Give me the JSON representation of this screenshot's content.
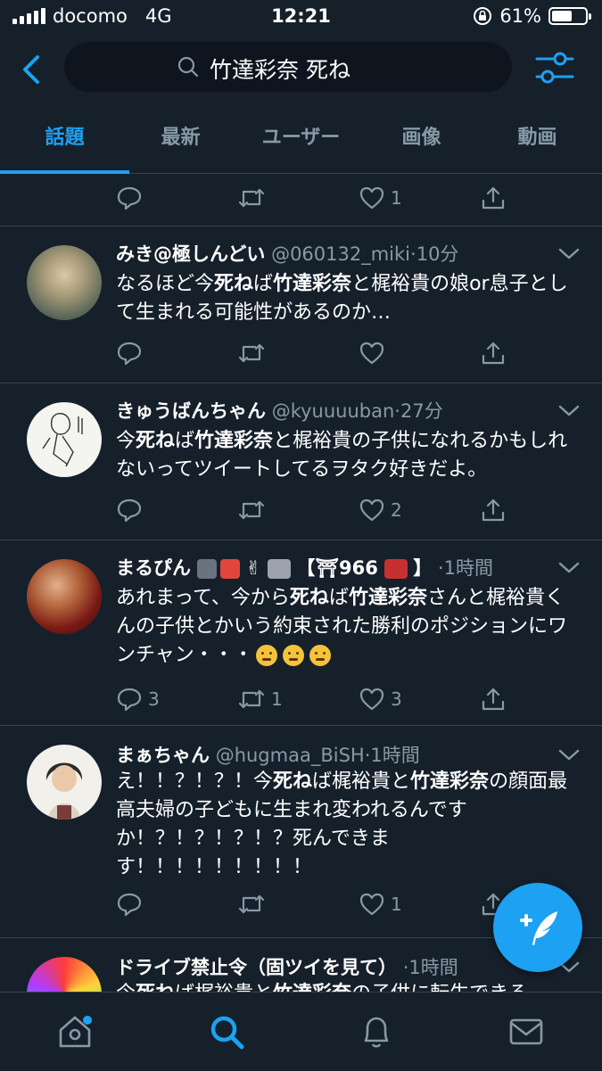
{
  "status_bar": {
    "carrier": "docomo",
    "network": "4G",
    "time": "12:21",
    "battery": "61%",
    "battery_level": 0.61
  },
  "search": {
    "query": "竹達彩奈 死ね"
  },
  "tabs": [
    {
      "label": "話題",
      "active": true
    },
    {
      "label": "最新",
      "active": false
    },
    {
      "label": "ユーザー",
      "active": false
    },
    {
      "label": "画像",
      "active": false
    },
    {
      "label": "動画",
      "active": false
    }
  ],
  "prev_tweet_actions": {
    "reply": "",
    "retweet": "",
    "like": "1"
  },
  "tweets": [
    {
      "name": "みき@極しんどい",
      "handle": "@060132_miki",
      "time": "10分",
      "body_parts": [
        "なるほど今",
        "死ね",
        "ば",
        "竹達彩奈",
        "と梶裕貴の娘or息子として生まれる可能性があるのか…"
      ],
      "reply": "",
      "retweet": "",
      "like": ""
    },
    {
      "name": "きゅうばんちゃん",
      "handle": "@kyuuuuban",
      "time": "27分",
      "body_parts": [
        "今",
        "死ね",
        "ば",
        "竹達彩奈",
        "と梶裕貴の子供になれるかもしれないってツイートしてるヲタク好きだよ。"
      ],
      "reply": "",
      "retweet": "",
      "like": "2"
    },
    {
      "name": "まるぴん",
      "name_suffix_1": "✌",
      "name_suffix_2": "【⛩966",
      "name_suffix_3": "】",
      "handle": "",
      "time": "1時間",
      "body_parts": [
        "あれまって、今から",
        "死ね",
        "ば",
        "竹達彩奈",
        "さんと梶裕貴くんの子供とかいう約束された勝利のポジションにワンチャン・・・"
      ],
      "reply": "3",
      "retweet": "1",
      "like": "3"
    },
    {
      "name": "まぁちゃん",
      "handle": "@hugmaa_BiSH",
      "time": "1時間",
      "body_parts": [
        "え！！？！？！今",
        "死ね",
        "ば梶裕貴と",
        "竹達彩奈",
        "の顔面最高夫婦の子どもに生まれ変われるんですか！？！？！？！？死んできます！！！！！！！！！"
      ],
      "reply": "",
      "retweet": "",
      "like": "1"
    },
    {
      "name": "ドライブ禁止令（固ツイを見て）",
      "handle": "",
      "time": "1時間",
      "body_parts": [
        "今",
        "死ね",
        "ば梶裕貴と",
        "竹達彩奈",
        "の子供に転生できる"
      ],
      "reply": "",
      "retweet": "",
      "like": ""
    }
  ],
  "icons": {
    "back": "chevron-left-icon",
    "search": "search-icon",
    "filter": "sliders-icon",
    "compose": "compose-tweet-icon",
    "nav": [
      "home-icon",
      "search-icon",
      "bell-icon",
      "mail-icon"
    ]
  },
  "colors": {
    "accent": "#1da1f2",
    "background": "#15202b",
    "muted": "#8899a6",
    "divider": "#38444d"
  }
}
